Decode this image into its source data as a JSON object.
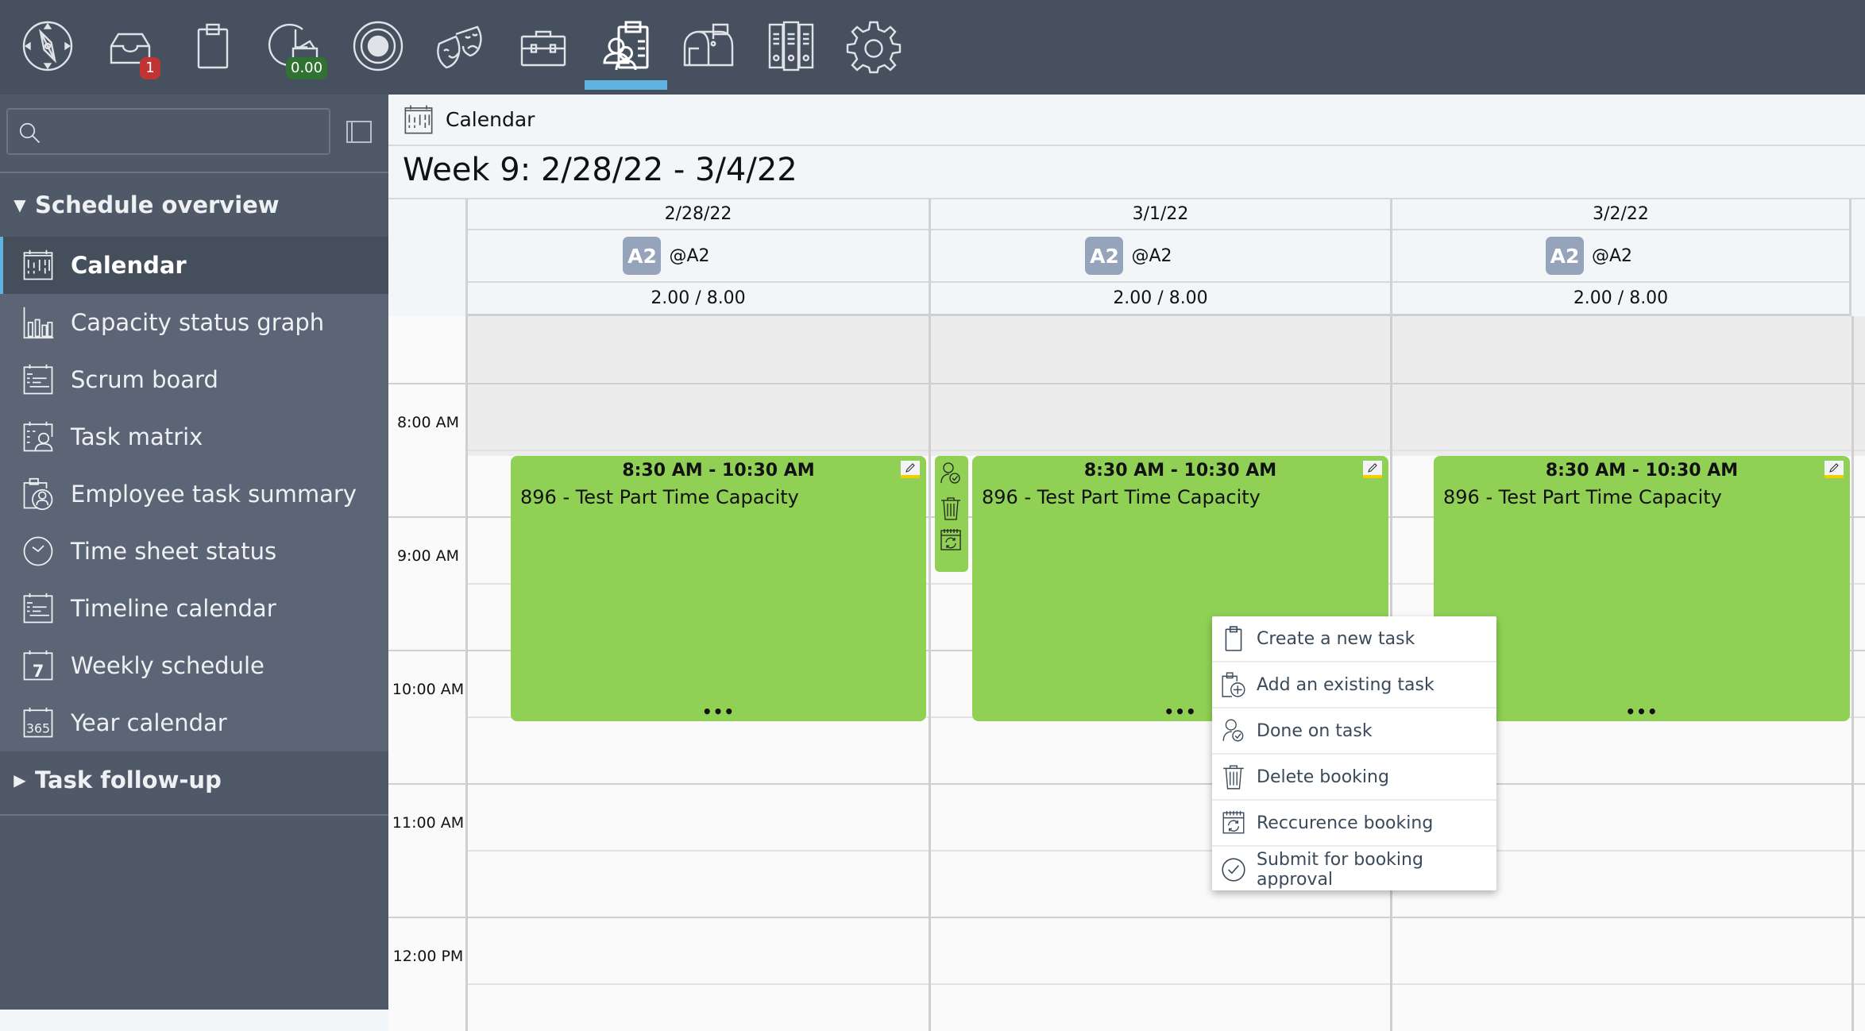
{
  "topnav": {
    "icons": [
      {
        "name": "compass-icon",
        "label": "Navigator"
      },
      {
        "name": "inbox-icon",
        "label": "Inbox",
        "badge": "1"
      },
      {
        "name": "clipboard-icon",
        "label": "Tasks"
      },
      {
        "name": "time-report-icon",
        "label": "Time",
        "badge": "0.00"
      },
      {
        "name": "target-icon",
        "label": "Goals"
      },
      {
        "name": "theater-masks-icon",
        "label": "Social"
      },
      {
        "name": "toolbox-icon",
        "label": "Tools"
      },
      {
        "name": "team-schedule-icon",
        "label": "Schedule",
        "active": true
      },
      {
        "name": "mailbox-icon",
        "label": "Mailbox"
      },
      {
        "name": "binders-icon",
        "label": "Archive"
      },
      {
        "name": "gear-icon",
        "label": "Settings"
      }
    ],
    "inbox_badge": "1",
    "time_badge": "0.00",
    "colors": {
      "active": "#5eb3e0",
      "badge_red": "#c03434",
      "badge_green": "#2f7231"
    }
  },
  "sidebar": {
    "search": {
      "value": "",
      "placeholder": ""
    },
    "sections": [
      {
        "label": "Schedule overview",
        "expanded": true
      },
      {
        "label": "Task follow-up",
        "expanded": false
      }
    ],
    "items": [
      {
        "label": "Calendar",
        "icon": "calendar-icon",
        "active": true
      },
      {
        "label": "Capacity status graph",
        "icon": "bar-graph-icon"
      },
      {
        "label": "Scrum board",
        "icon": "scrum-board-icon"
      },
      {
        "label": "Task matrix",
        "icon": "task-matrix-icon"
      },
      {
        "label": "Employee task summary",
        "icon": "employee-summary-icon"
      },
      {
        "label": "Time sheet status",
        "icon": "clock-icon"
      },
      {
        "label": "Timeline calendar",
        "icon": "timeline-icon"
      },
      {
        "label": "Weekly schedule",
        "icon": "weekly-calendar-icon",
        "icon_text": "7"
      },
      {
        "label": "Year calendar",
        "icon": "year-calendar-icon",
        "icon_text": "365"
      }
    ]
  },
  "main": {
    "breadcrumb": "Calendar",
    "week_title": "Week 9: 2/28/22 - 3/4/22",
    "days": [
      {
        "date": "2/28/22",
        "avatar": "A2",
        "user": "@A2",
        "capacity": "2.00 / 8.00"
      },
      {
        "date": "3/1/22",
        "avatar": "A2",
        "user": "@A2",
        "capacity": "2.00 / 8.00"
      },
      {
        "date": "3/2/22",
        "avatar": "A2",
        "user": "@A2",
        "capacity": "2.00 / 8.00"
      }
    ],
    "time_labels": [
      "8:00 AM",
      "9:00 AM",
      "10:00 AM",
      "11:00 AM",
      "12:00 PM"
    ],
    "bookings": [
      {
        "day": 0,
        "time": "8:30 AM - 10:30 AM",
        "title": "896 - Test Part Time Capacity",
        "more": "•••",
        "color": "#90d155"
      },
      {
        "day": 1,
        "time": "8:30 AM - 10:30 AM",
        "title": "896 - Test Part Time Capacity",
        "more": "•••",
        "color": "#90d155"
      },
      {
        "day": 2,
        "time": "8:30 AM - 10:30 AM",
        "title": "896 - Test Part Time Capacity",
        "more": "•••",
        "color": "#90d155"
      }
    ],
    "booking_side_actions": [
      "done-on-task-icon",
      "trash-icon",
      "recurrence-icon"
    ]
  },
  "context_menu": {
    "items": [
      {
        "label": "Create a new task",
        "icon": "clipboard-icon"
      },
      {
        "label": "Add an existing task",
        "icon": "clipboard-add-icon"
      },
      {
        "label": "Done on task",
        "icon": "user-check-icon"
      },
      {
        "label": "Delete booking",
        "icon": "trash-icon"
      },
      {
        "label": "Reccurence booking",
        "icon": "recurrence-icon"
      },
      {
        "label": "Submit for booking approval",
        "icon": "check-circle-icon"
      }
    ]
  }
}
